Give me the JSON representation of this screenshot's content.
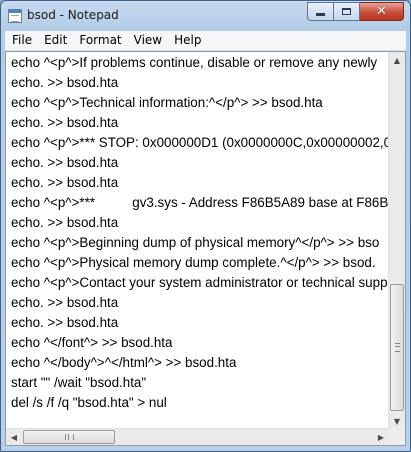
{
  "window": {
    "title": "bsod - Notepad",
    "icon": "notepad-icon",
    "buttons": {
      "minimize": "minimize-icon",
      "maximize": "maximize-icon",
      "close": "close-icon"
    }
  },
  "menu": {
    "items": [
      "File",
      "Edit",
      "Format",
      "View",
      "Help"
    ]
  },
  "document": {
    "lines": [
      "echo ^<p^>If problems continue, disable or remove any newly",
      "echo. >> bsod.hta",
      "echo ^<p^>Technical information:^</p^> >> bsod.hta",
      "echo. >> bsod.hta",
      "echo ^<p^>*** STOP: 0x000000D1 (0x0000000C,0x00000002,0x",
      "echo. >> bsod.hta",
      "echo. >> bsod.hta",
      "echo ^<p^>***          gv3.sys - Address F86B5A89 base at F86B5",
      "echo. >> bsod.hta",
      "echo ^<p^>Beginning dump of physical memory^</p^> >> bso",
      "echo ^<p^>Physical memory dump complete.^</p^> >> bsod.",
      "echo ^<p^>Contact your system administrator or technical supp",
      "echo. >> bsod.hta",
      "echo. >> bsod.hta",
      "echo ^</font^> >> bsod.hta",
      "echo ^</body^>^</html^> >> bsod.hta",
      "start \"\" /wait \"bsod.hta\"",
      "del /s /f /q \"bsod.hta\" > nul"
    ]
  },
  "scrollbars": {
    "vertical_position": 0.84,
    "horizontal_position": 0.0
  },
  "colors": {
    "chrome": "#b9d0ea",
    "close_button": "#c7503a",
    "text": "#000000",
    "background": "#ffffff"
  }
}
